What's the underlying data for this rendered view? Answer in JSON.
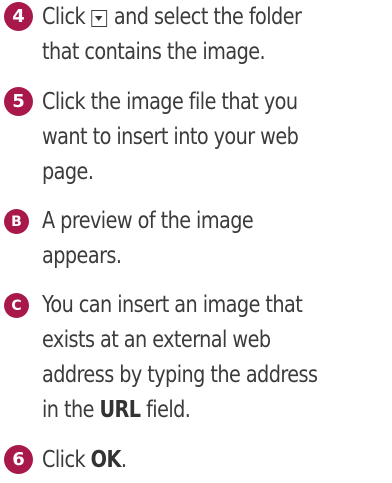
{
  "steps": [
    {
      "badge": "4",
      "line1_before": "Click",
      "icon": "dropdown-arrow-icon",
      "line1_after": "and select the folder",
      "line2": "that contains the image."
    },
    {
      "badge": "5",
      "lines": [
        "Click the image file that you",
        "want to insert into your web",
        "page."
      ]
    },
    {
      "badge": "B",
      "lines": [
        "A preview of the image",
        "appears."
      ]
    },
    {
      "badge": "C",
      "lines": [
        "You can insert an image that",
        "exists at an external web",
        "address by typing the address"
      ],
      "last_before": "in the",
      "last_bold": "URL",
      "last_after": "field."
    },
    {
      "badge": "6",
      "before": "Click",
      "bold": "OK",
      "after": "."
    }
  ],
  "colors": {
    "badge": "#a8184a",
    "text": "#3b3b3b"
  }
}
